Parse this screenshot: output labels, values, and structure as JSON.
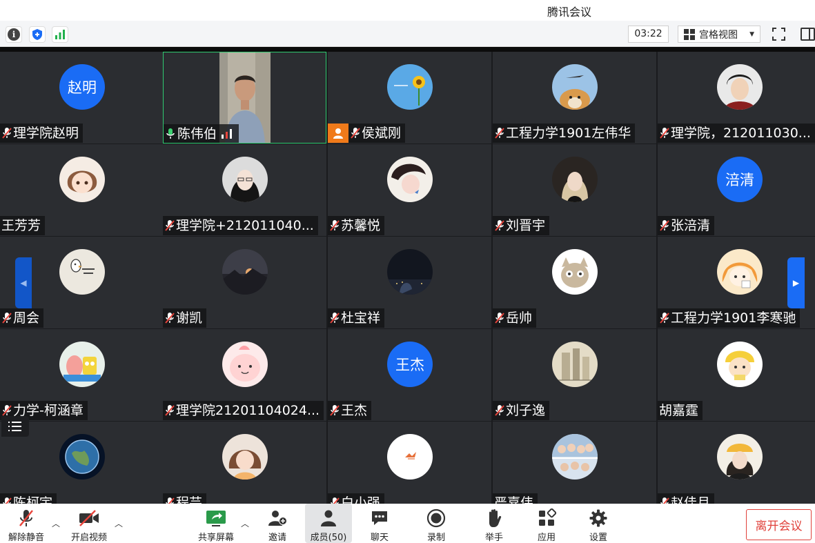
{
  "window": {
    "title": "腾讯会议"
  },
  "toolbar": {
    "timer": "03:22",
    "view_label": "宫格视图"
  },
  "participants": [
    {
      "name": "理学院赵明",
      "mic": "off",
      "avatar_text": "赵明"
    },
    {
      "name": "陈伟伯",
      "mic": "on",
      "video": true
    },
    {
      "name": "侯斌刚",
      "mic": "off",
      "host": true
    },
    {
      "name": "工程力学1901左伟华",
      "mic": "off"
    },
    {
      "name": "理学院，212011030...",
      "mic": "off"
    },
    {
      "name": "王芳芳",
      "mic": "none"
    },
    {
      "name": "理学院+212011040...",
      "mic": "off"
    },
    {
      "name": "苏馨悦",
      "mic": "off"
    },
    {
      "name": "刘晋宇",
      "mic": "off"
    },
    {
      "name": "张涪清",
      "mic": "off",
      "avatar_text": "涪清"
    },
    {
      "name": "周会",
      "mic": "off"
    },
    {
      "name": "谢凯",
      "mic": "off"
    },
    {
      "name": "杜宝祥",
      "mic": "off"
    },
    {
      "name": "岳帅",
      "mic": "off"
    },
    {
      "name": "工程力学1901李寒驰",
      "mic": "off"
    },
    {
      "name": "力学-柯涵章",
      "mic": "off"
    },
    {
      "name": "理学院21201104024...",
      "mic": "off"
    },
    {
      "name": "王杰",
      "mic": "off",
      "avatar_text": "王杰"
    },
    {
      "name": "刘子逸",
      "mic": "off"
    },
    {
      "name": "胡嘉霆",
      "mic": "none"
    },
    {
      "name": "陈柯宇",
      "mic": "off"
    },
    {
      "name": "程芸",
      "mic": "off"
    },
    {
      "name": "白小强",
      "mic": "off"
    },
    {
      "name": "严嘉伟",
      "mic": "none"
    },
    {
      "name": "赵佳月",
      "mic": "off"
    }
  ],
  "bottombar": {
    "unmute": "解除静音",
    "start_video": "开启视频",
    "share_screen": "共享屏幕",
    "invite": "邀请",
    "members": "成员(50)",
    "chat": "聊天",
    "record": "录制",
    "raise_hand": "举手",
    "apps": "应用",
    "settings": "设置",
    "leave": "离开会议"
  },
  "colors": {
    "accent": "#1a6cf5",
    "tile_bg": "#2b2d31",
    "leave": "#e0403a",
    "host_badge": "#f07a1a",
    "active_border": "#2ecc71"
  }
}
